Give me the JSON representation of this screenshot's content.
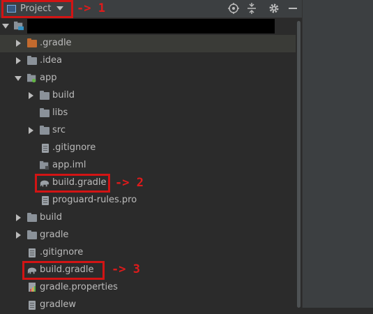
{
  "header": {
    "dropdown_label": "Project",
    "icons": [
      "target-icon",
      "collapse-icon",
      "gear-icon",
      "minimize-icon"
    ]
  },
  "tree": {
    "rows": [
      {
        "label": "",
        "kind": "root-module",
        "expanded": true
      },
      {
        "label": ".gradle",
        "kind": "folder-orange",
        "expanded": false
      },
      {
        "label": ".idea",
        "kind": "folder",
        "expanded": false
      },
      {
        "label": "app",
        "kind": "module-folder",
        "expanded": true
      },
      {
        "label": "build",
        "kind": "folder",
        "expanded": false
      },
      {
        "label": "libs",
        "kind": "folder"
      },
      {
        "label": "src",
        "kind": "folder",
        "expanded": false
      },
      {
        "label": ".gitignore",
        "kind": "file"
      },
      {
        "label": "app.iml",
        "kind": "iml-file"
      },
      {
        "label": "build.gradle",
        "kind": "gradle-file"
      },
      {
        "label": "proguard-rules.pro",
        "kind": "file"
      },
      {
        "label": "build",
        "kind": "folder",
        "expanded": false
      },
      {
        "label": "gradle",
        "kind": "folder",
        "expanded": false
      },
      {
        "label": ".gitignore",
        "kind": "file"
      },
      {
        "label": "build.gradle",
        "kind": "gradle-file"
      },
      {
        "label": "gradle.properties",
        "kind": "properties-file"
      },
      {
        "label": "gradlew",
        "kind": "file"
      }
    ]
  },
  "annotations": {
    "one": "-> 1",
    "two": "-> 2",
    "three": "-> 3"
  },
  "colors": {
    "background": "#2b2b2b",
    "panel": "#3c3f41",
    "annotation_red": "#d21414",
    "folder_orange": "#c26a2e"
  }
}
